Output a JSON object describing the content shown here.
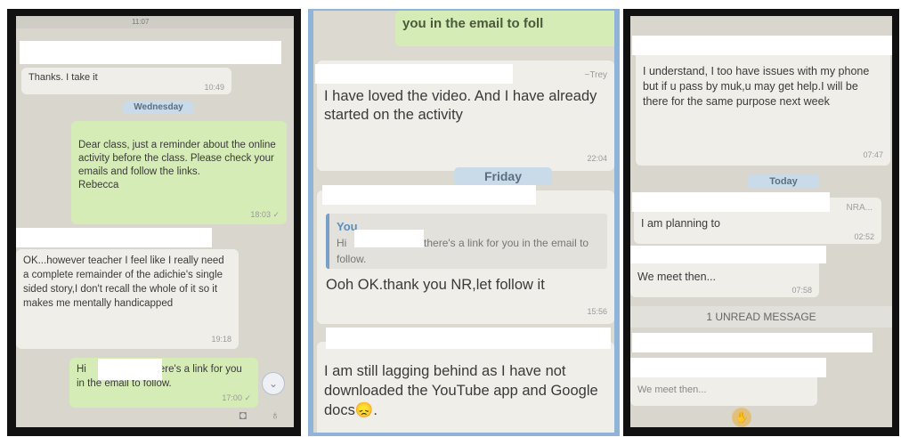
{
  "panel1": {
    "status_time": "11:07",
    "messages": [
      {
        "text": "Thanks. I take it",
        "time": "10:49"
      },
      {
        "text": "Dear class, just a reminder about the online activity before the class. Please check your emails and follow the links.\nRebecca",
        "time": "18:03 ✓"
      },
      {
        "text": "OK...however teacher I feel like I really need a complete remainder of the adichie's single sided story,I don't recall the whole of it so it makes me mentally handicapped",
        "time": "19:18"
      },
      {
        "prefix": "Hi",
        "suffix": "there's a link for you in the email to follow.",
        "time": "17:00 ✓"
      }
    ],
    "day_label": "Wednesday"
  },
  "panel2": {
    "top_fragment": "you in the email to foll",
    "top_sender": "~Trey",
    "messages": [
      {
        "text": "I have loved the video. And I have already started on the activity",
        "time": "22:04"
      },
      {
        "text": "Ooh OK.thank you NR,let follow it",
        "time": "15:56"
      },
      {
        "text": "I am still lagging behind as I have not downloaded the YouTube app and Google docs😞.",
        "time": ""
      }
    ],
    "day_label": "Friday",
    "quote": {
      "author": "You",
      "prefix": "Hi",
      "suffix": "there's a link for you in the email to follow."
    }
  },
  "panel3": {
    "messages": [
      {
        "text": "I understand, I too have issues with my phone but if u pass by muk,u may get help.I will be there for the same purpose next week",
        "time": "07:47"
      },
      {
        "text": "I am planning to",
        "time": "02:52"
      },
      {
        "text": "We meet then...",
        "time": "07:58"
      },
      {
        "text": "We meet then...",
        "time": ""
      }
    ],
    "day_label": "Today",
    "unread": "1 UNREAD MESSAGE",
    "fragment": "NRA..."
  }
}
